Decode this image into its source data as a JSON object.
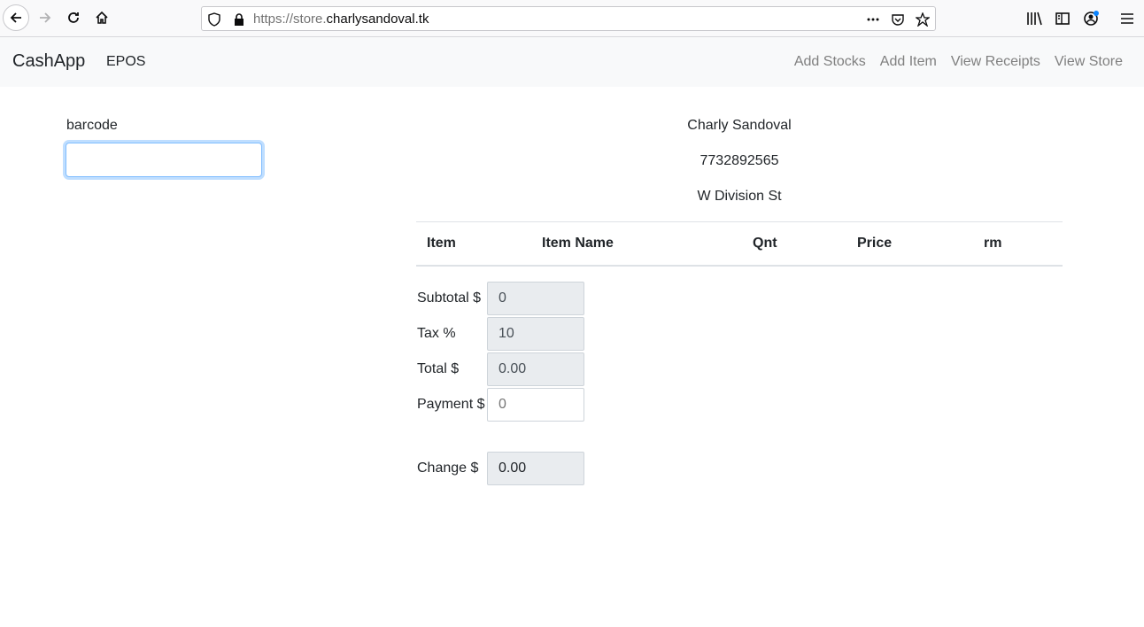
{
  "browser": {
    "url_protocol": "https://store.",
    "url_domain": "charlysandoval.tk"
  },
  "navbar": {
    "brand": "CashApp",
    "epos": "EPOS",
    "links": [
      "Add Stocks",
      "Add Item",
      "View Receipts",
      "View Store"
    ]
  },
  "barcode": {
    "label": "barcode",
    "value": ""
  },
  "store": {
    "name": "Charly Sandoval",
    "phone": "7732892565",
    "address": "W Division St"
  },
  "table": {
    "headers": [
      "Item",
      "Item Name",
      "Qnt",
      "Price",
      "rm"
    ]
  },
  "totals": {
    "subtotal_label": "Subtotal $",
    "subtotal_value": "0",
    "tax_label": "Tax %",
    "tax_value": "10",
    "total_label": "Total $",
    "total_value": "0.00",
    "payment_label": "Payment $",
    "payment_placeholder": "0",
    "change_label": "Change $",
    "change_value": "0.00"
  }
}
